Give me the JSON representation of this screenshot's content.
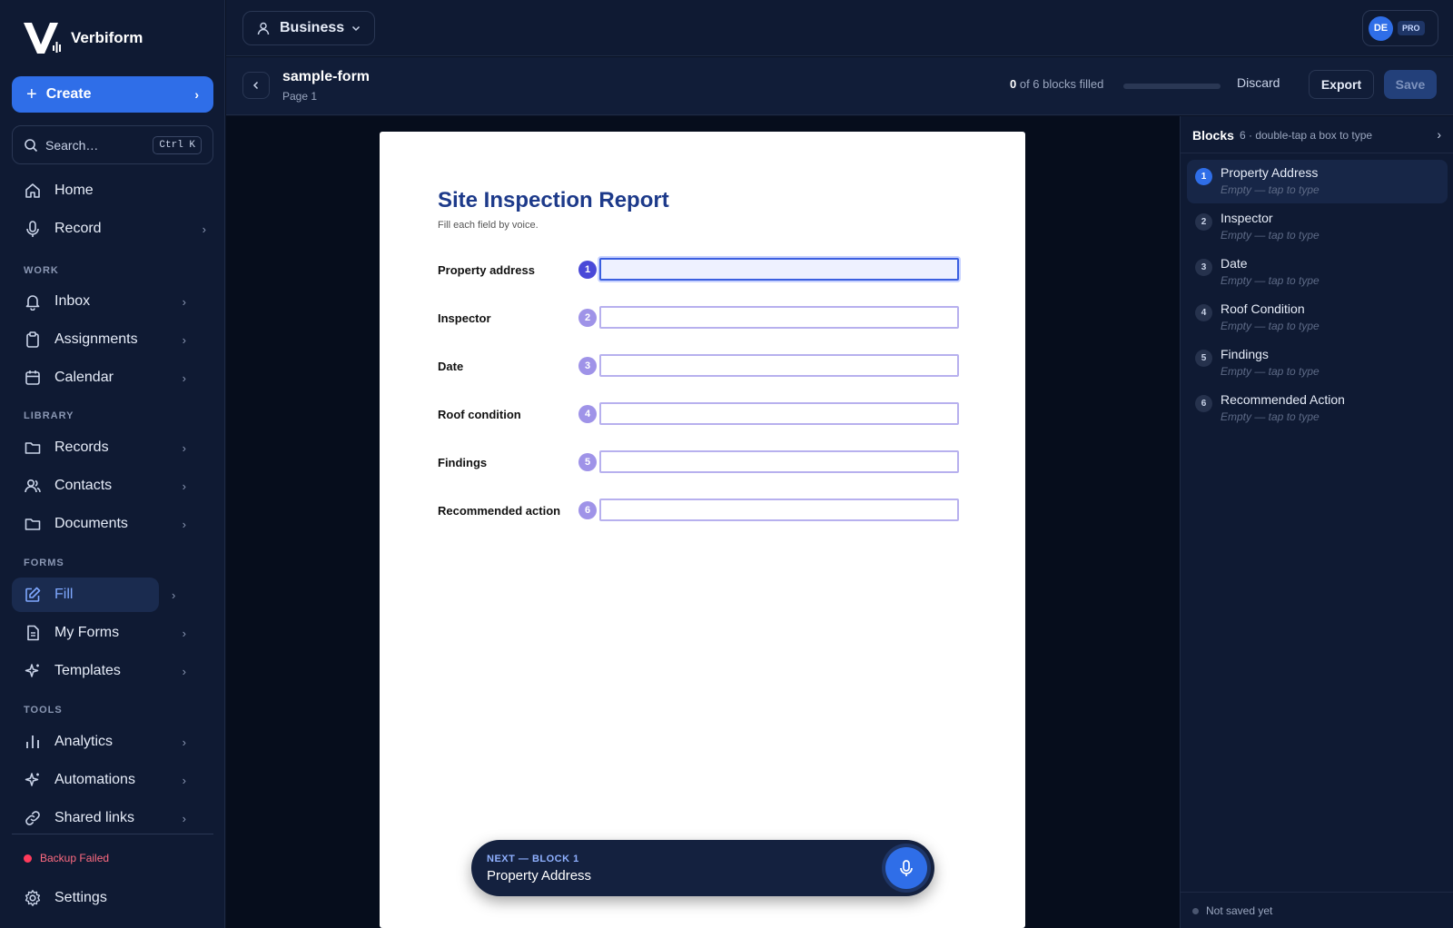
{
  "brand": {
    "name": "Verbiform"
  },
  "sidebar": {
    "create_label": "Create",
    "search": {
      "placeholder": "Search…",
      "shortcut": "Ctrl K"
    },
    "top_items": [
      {
        "label": "Home",
        "icon": "home-icon"
      },
      {
        "label": "Record",
        "icon": "mic-icon"
      }
    ],
    "sections": [
      {
        "label": "WORK",
        "items": [
          {
            "label": "Inbox",
            "icon": "bell-icon"
          },
          {
            "label": "Assignments",
            "icon": "clipboard-icon"
          },
          {
            "label": "Calendar",
            "icon": "calendar-icon"
          }
        ]
      },
      {
        "label": "LIBRARY",
        "items": [
          {
            "label": "Records",
            "icon": "folder-icon"
          },
          {
            "label": "Contacts",
            "icon": "users-icon"
          },
          {
            "label": "Documents",
            "icon": "folder-icon"
          }
        ]
      },
      {
        "label": "FORMS",
        "items": [
          {
            "label": "Fill",
            "icon": "edit-icon"
          },
          {
            "label": "My Forms",
            "icon": "file-icon"
          },
          {
            "label": "Templates",
            "icon": "sparkle-icon"
          }
        ]
      },
      {
        "label": "TOOLS",
        "items": [
          {
            "label": "Analytics",
            "icon": "bar-chart-icon"
          },
          {
            "label": "Automations",
            "icon": "sparkle-icon"
          },
          {
            "label": "Shared links",
            "icon": "link-icon"
          }
        ]
      }
    ],
    "backup_status": "Backup Failed",
    "settings_label": "Settings"
  },
  "topbar": {
    "workspace": "Business",
    "user_initials": "DE",
    "plan_badge": "PRO"
  },
  "document": {
    "title": "sample-form",
    "page_label": "Page 1",
    "progress_filled": "0",
    "progress_suffix": " of 6 blocks filled",
    "progress_fraction": 0,
    "discard_label": "Discard",
    "export_label": "Export",
    "save_label": "Save"
  },
  "form": {
    "title": "Site Inspection Report",
    "subtitle": "Fill each field by voice.",
    "fields": [
      {
        "num": "1",
        "label": "Property address",
        "value": ""
      },
      {
        "num": "2",
        "label": "Inspector",
        "value": ""
      },
      {
        "num": "3",
        "label": "Date",
        "value": ""
      },
      {
        "num": "4",
        "label": "Roof condition",
        "value": ""
      },
      {
        "num": "5",
        "label": "Findings",
        "value": ""
      },
      {
        "num": "6",
        "label": "Recommended action",
        "value": ""
      }
    ]
  },
  "voice": {
    "kicker": "NEXT — BLOCK 1",
    "next_block": "Property Address"
  },
  "blocks_panel": {
    "title": "Blocks",
    "count_hint": "6 · double-tap a box to type",
    "items": [
      {
        "num": "1",
        "name": "Property Address",
        "status": "Empty — tap to type"
      },
      {
        "num": "2",
        "name": "Inspector",
        "status": "Empty — tap to type"
      },
      {
        "num": "3",
        "name": "Date",
        "status": "Empty — tap to type"
      },
      {
        "num": "4",
        "name": "Roof Condition",
        "status": "Empty — tap to type"
      },
      {
        "num": "5",
        "name": "Findings",
        "status": "Empty — tap to type"
      },
      {
        "num": "6",
        "name": "Recommended Action",
        "status": "Empty — tap to type"
      }
    ],
    "footer_status": "Not saved yet"
  },
  "colors": {
    "accent": "#2f6ee8",
    "error": "#ff3b5c",
    "form_title": "#1d3a8a",
    "field_border": "#b7b0ee"
  }
}
